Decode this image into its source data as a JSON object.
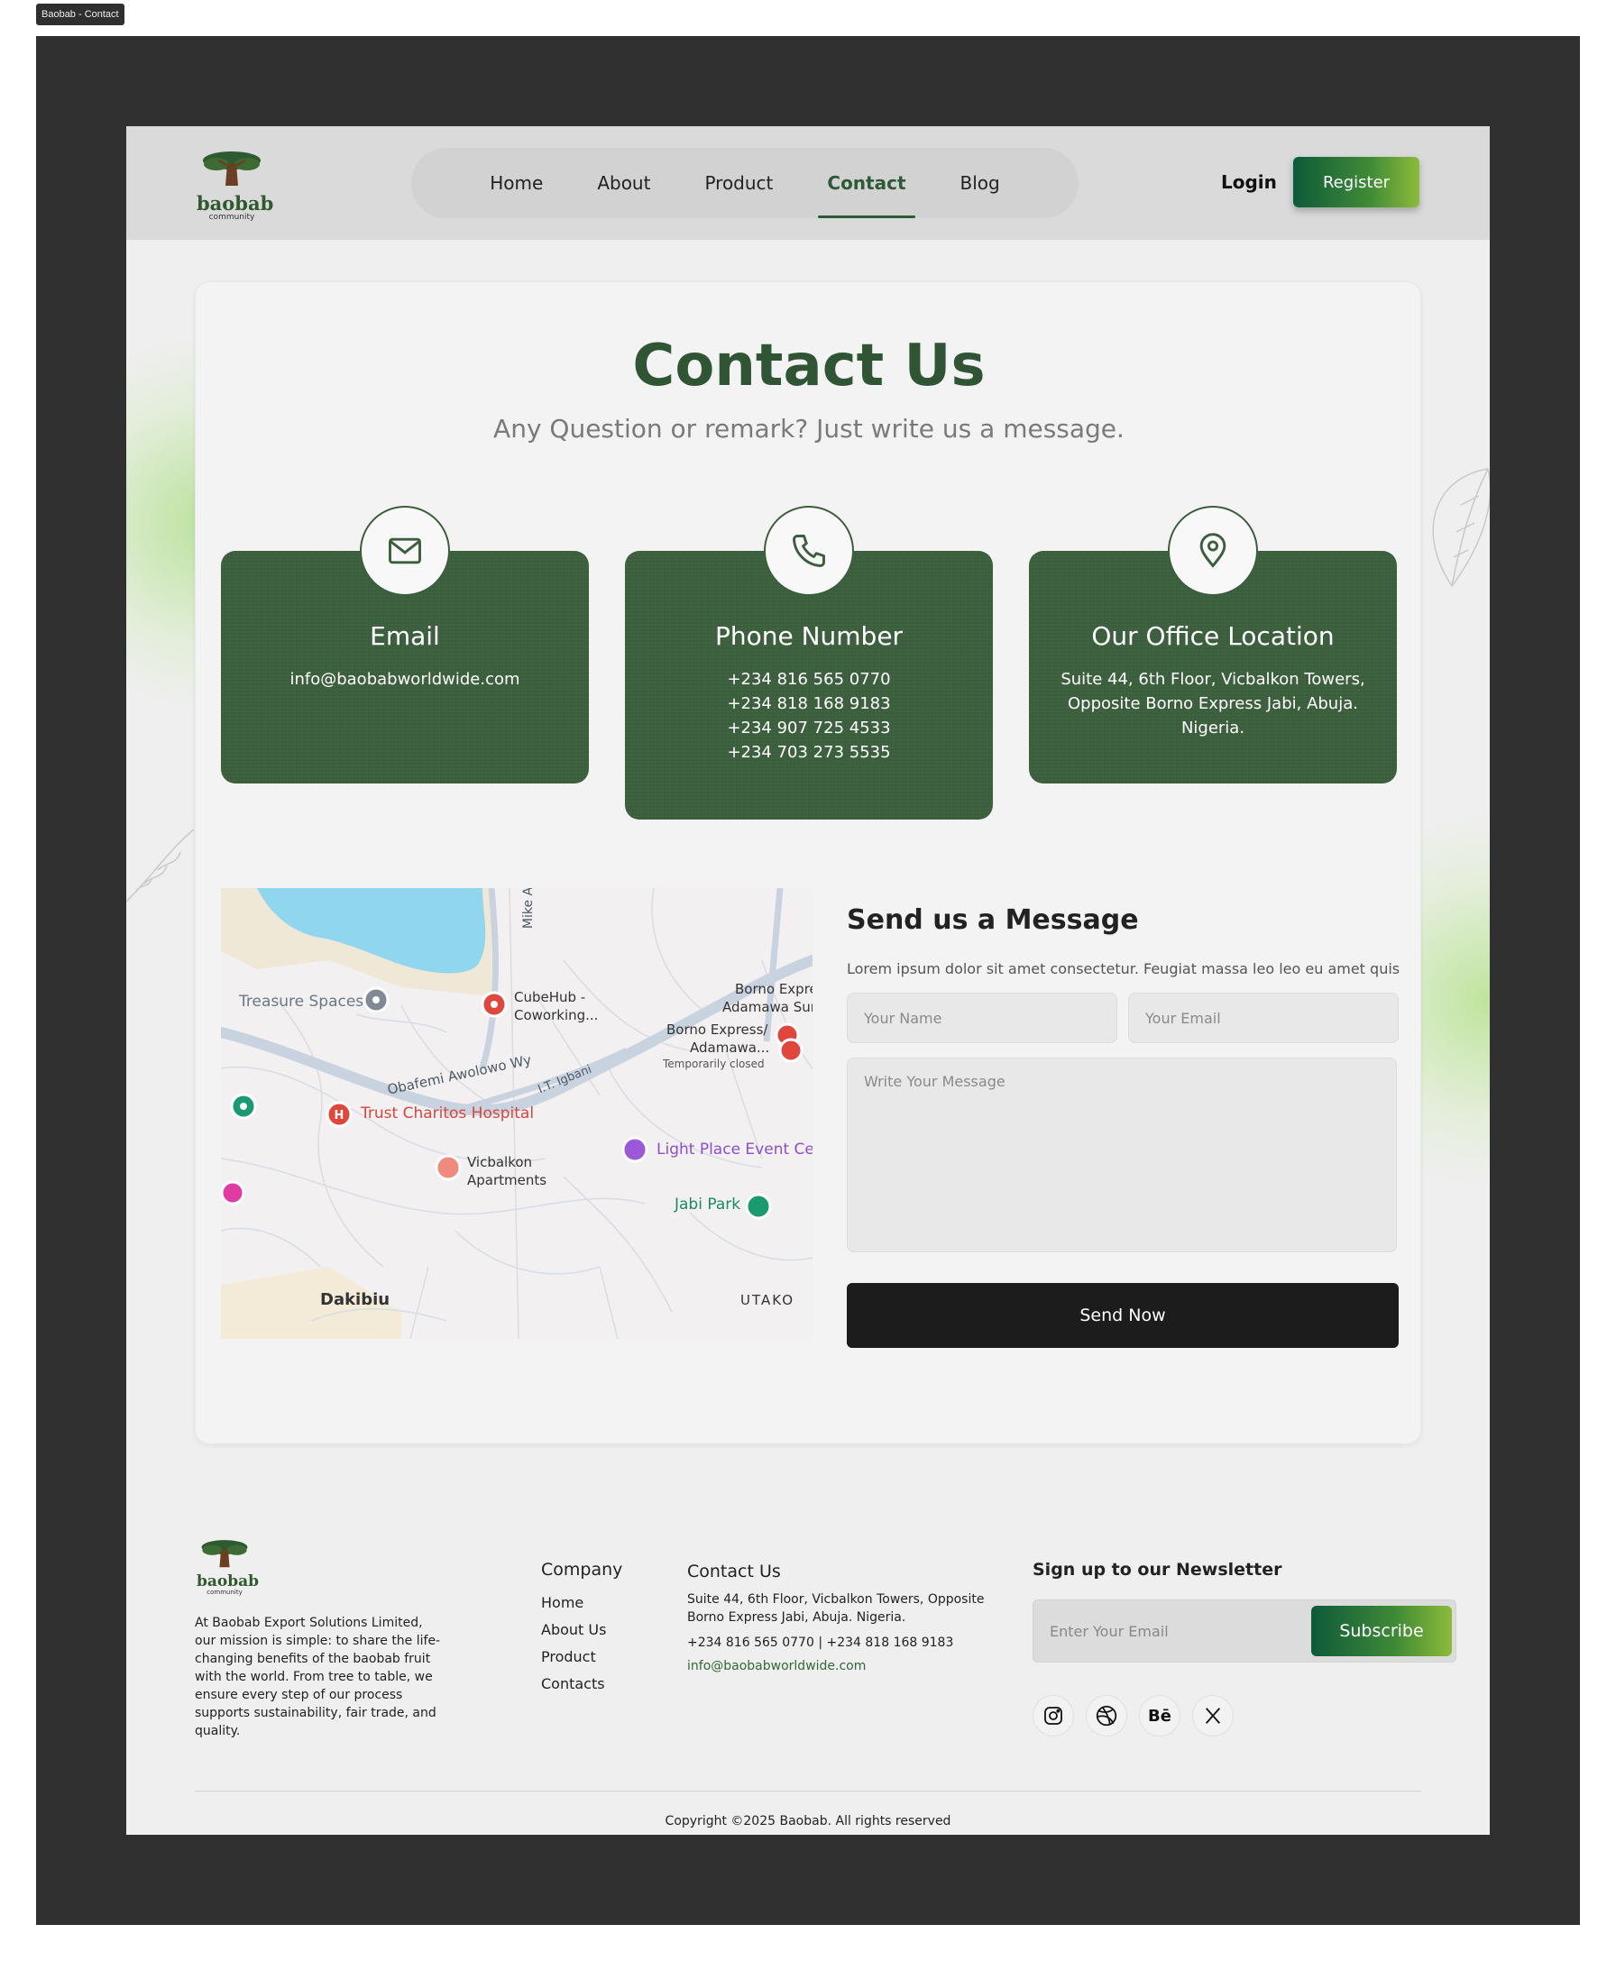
{
  "frame_tag": "Baobab - Contact",
  "brand": {
    "logo_word": "baobab",
    "logo_sub": "community"
  },
  "nav": {
    "items": [
      "Home",
      "About",
      "Product",
      "Contact",
      "Blog"
    ],
    "active": "Contact"
  },
  "auth": {
    "login": "Login",
    "register": "Register"
  },
  "hero": {
    "title": "Contact Us",
    "subtitle": "Any Question or remark? Just write us a message."
  },
  "cards": {
    "email": {
      "title": "Email",
      "value": "info@baobabworldwide.com",
      "icon": "mail-icon"
    },
    "phone": {
      "title": "Phone Number",
      "lines": [
        "+234 816 565 0770",
        "+234 818 168 9183",
        "+234 907 725 4533",
        "+234 703 273 5535"
      ],
      "icon": "phone-icon"
    },
    "office": {
      "title": "Our Office Location",
      "lines": [
        "Suite 44, 6th Floor, Vicbalkon Towers,",
        "Opposite Borno Express Jabi, Abuja.",
        "Nigeria."
      ],
      "icon": "location-pin-icon"
    }
  },
  "map": {
    "labels": {
      "treasure": "Treasure Spaces",
      "cubehub1": "CubeHub -",
      "cubehub2": "Coworking...",
      "borno1": "Borno Expre",
      "borno2": "Adamawa Sur",
      "borno3": "Borno Express/",
      "borno4": "Adamawa...",
      "closed": "Temporarily closed",
      "obafemi": "Obafemi Awolowo Wy",
      "igbani": "I.T. Igbani",
      "mike": "Mike A",
      "trust": "Trust Charitos Hospital",
      "vic1": "Vicbalkon",
      "vic2": "Apartments",
      "light": "Light Place Event Cen",
      "jabi": "Jabi Park",
      "dakibiu": "Dakibiu",
      "utako": "UTAKO"
    }
  },
  "form": {
    "title": "Send us a Message",
    "description": "Lorem ipsum dolor sit amet consectetur. Feugiat massa leo leo eu amet quis",
    "name_placeholder": "Your Name",
    "email_placeholder": "Your Email",
    "message_placeholder": "Write Your Message",
    "send_label": "Send Now"
  },
  "footer": {
    "about": "At Baobab Export Solutions Limited, our mission is simple: to share the life-changing benefits of the baobab fruit with the world. From tree to table, we ensure every step of our process supports sustainability, fair trade, and quality.",
    "company_heading": "Company",
    "company_links": [
      "Home",
      "About Us",
      "Product",
      "Contacts"
    ],
    "contact_heading": "Contact Us",
    "contact_address": "Suite 44, 6th Floor, Vicbalkon Towers, Opposite Borno Express Jabi, Abuja. Nigeria.",
    "contact_phones": "+234 816 565 0770 | +234 818 168 9183",
    "contact_email": "info@baobabworldwide.com",
    "newsletter_heading": "Sign up to our Newsletter",
    "newsletter_placeholder": "Enter Your Email",
    "subscribe_label": "Subscribe",
    "social": [
      "instagram-icon",
      "dribbble-icon",
      "behance-icon",
      "x-icon"
    ],
    "behance_text": "Bē",
    "copyright": "Copyright ©2025  Baobab. All rights reserved"
  },
  "colors": {
    "brand_green": "#3b5f3c",
    "title_green": "#2f5534",
    "dark_button": "#1c1c1c",
    "gradient_start": "#0e5a3a",
    "gradient_end": "#8dbb3a"
  }
}
